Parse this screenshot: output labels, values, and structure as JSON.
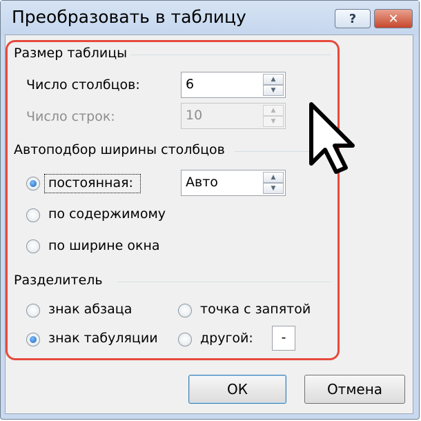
{
  "window": {
    "title": "Преобразовать в таблицу",
    "help_glyph": "?",
    "close_glyph": "✕"
  },
  "table_size": {
    "title": "Размер таблицы",
    "columns_label": "Число столбцов:",
    "columns_value": "6",
    "rows_label": "Число строк:",
    "rows_value": "10",
    "rows_disabled": true
  },
  "autofit": {
    "title": "Автоподбор ширины столбцов",
    "options": [
      {
        "label": "постоянная:",
        "checked": true
      },
      {
        "label": "по содержимому",
        "checked": false
      },
      {
        "label": "по ширине окна",
        "checked": false
      }
    ],
    "width_value": "Авто"
  },
  "separator": {
    "title": "Разделитель",
    "options": [
      {
        "label": "знак абзаца",
        "checked": false
      },
      {
        "label": "точка с запятой",
        "checked": false
      },
      {
        "label": "знак табуляции",
        "checked": true
      },
      {
        "label": "другой:",
        "checked": false
      }
    ],
    "other_value": "-"
  },
  "buttons": {
    "ok": "ОК",
    "cancel": "Отмена"
  },
  "spin_glyphs": {
    "up": "▲",
    "down": "▼"
  },
  "colors": {
    "highlight": "#e64a3c",
    "radio_checked": "#1a62b8"
  }
}
